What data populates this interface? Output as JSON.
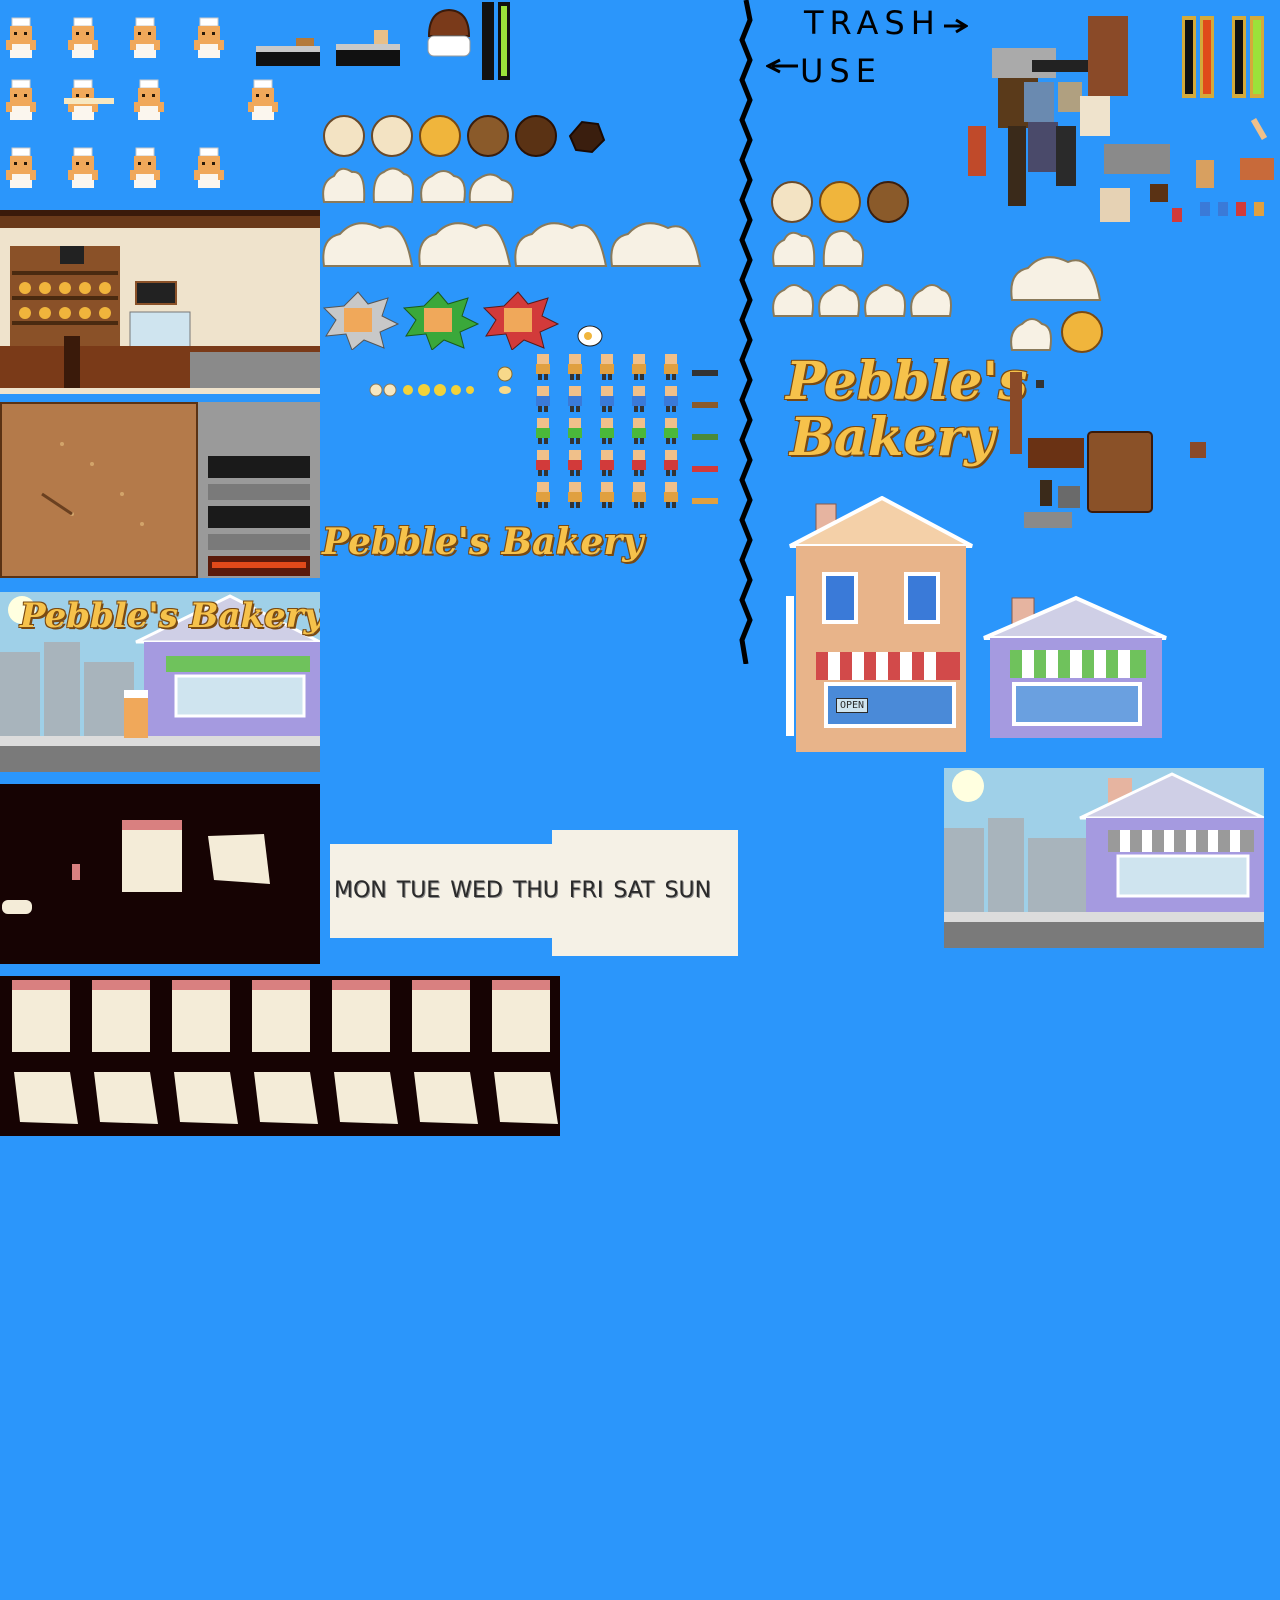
{
  "sheet": {
    "background_color": "#2b96fb",
    "divider_color": "#000000"
  },
  "labels": {
    "trash": "TRASH",
    "use": "USE"
  },
  "logos": {
    "large": {
      "line1": "Pebble's",
      "line2": "Bakery"
    },
    "small": "Pebble's Bakery",
    "scene": "Pebble's Bakery"
  },
  "shop_sign": {
    "open": "OPEN"
  },
  "weekdays": {
    "items": [
      "MON",
      "TUE",
      "WED",
      "THU",
      "FRI",
      "SAT",
      "SUN"
    ]
  },
  "colors": {
    "bun_light": "#f3e3c3",
    "bun_golden": "#f0b53c",
    "bun_brown": "#8a5a2a",
    "bun_dark": "#5a3214",
    "bun_burnt": "#3a1e0e",
    "dough": "#f7f1e4",
    "wood": "#b0703c",
    "brick_orange": "#e8b48a",
    "house_purple": "#a59ae0",
    "awning_red": "#d24a4a",
    "awning_green": "#6fc25c",
    "sky": "#9fd0e8"
  },
  "icons": {
    "baker": "baker-sprite-icon",
    "bun": "bread-bun-icon",
    "dough": "dough-icon",
    "meter": "meter-bar-icon",
    "customer": "customer-sprite-icon",
    "arrow": "arrow-icon"
  }
}
